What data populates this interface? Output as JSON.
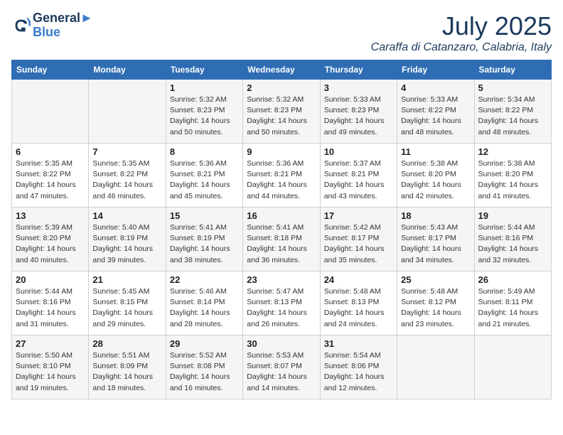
{
  "logo": {
    "line1": "General",
    "line2": "Blue"
  },
  "title": "July 2025",
  "location": "Caraffa di Catanzaro, Calabria, Italy",
  "days_of_week": [
    "Sunday",
    "Monday",
    "Tuesday",
    "Wednesday",
    "Thursday",
    "Friday",
    "Saturday"
  ],
  "weeks": [
    [
      {
        "day": "",
        "info": ""
      },
      {
        "day": "",
        "info": ""
      },
      {
        "day": "1",
        "info": "Sunrise: 5:32 AM\nSunset: 8:23 PM\nDaylight: 14 hours\nand 50 minutes."
      },
      {
        "day": "2",
        "info": "Sunrise: 5:32 AM\nSunset: 8:23 PM\nDaylight: 14 hours\nand 50 minutes."
      },
      {
        "day": "3",
        "info": "Sunrise: 5:33 AM\nSunset: 8:23 PM\nDaylight: 14 hours\nand 49 minutes."
      },
      {
        "day": "4",
        "info": "Sunrise: 5:33 AM\nSunset: 8:22 PM\nDaylight: 14 hours\nand 48 minutes."
      },
      {
        "day": "5",
        "info": "Sunrise: 5:34 AM\nSunset: 8:22 PM\nDaylight: 14 hours\nand 48 minutes."
      }
    ],
    [
      {
        "day": "6",
        "info": "Sunrise: 5:35 AM\nSunset: 8:22 PM\nDaylight: 14 hours\nand 47 minutes."
      },
      {
        "day": "7",
        "info": "Sunrise: 5:35 AM\nSunset: 8:22 PM\nDaylight: 14 hours\nand 46 minutes."
      },
      {
        "day": "8",
        "info": "Sunrise: 5:36 AM\nSunset: 8:21 PM\nDaylight: 14 hours\nand 45 minutes."
      },
      {
        "day": "9",
        "info": "Sunrise: 5:36 AM\nSunset: 8:21 PM\nDaylight: 14 hours\nand 44 minutes."
      },
      {
        "day": "10",
        "info": "Sunrise: 5:37 AM\nSunset: 8:21 PM\nDaylight: 14 hours\nand 43 minutes."
      },
      {
        "day": "11",
        "info": "Sunrise: 5:38 AM\nSunset: 8:20 PM\nDaylight: 14 hours\nand 42 minutes."
      },
      {
        "day": "12",
        "info": "Sunrise: 5:38 AM\nSunset: 8:20 PM\nDaylight: 14 hours\nand 41 minutes."
      }
    ],
    [
      {
        "day": "13",
        "info": "Sunrise: 5:39 AM\nSunset: 8:20 PM\nDaylight: 14 hours\nand 40 minutes."
      },
      {
        "day": "14",
        "info": "Sunrise: 5:40 AM\nSunset: 8:19 PM\nDaylight: 14 hours\nand 39 minutes."
      },
      {
        "day": "15",
        "info": "Sunrise: 5:41 AM\nSunset: 8:19 PM\nDaylight: 14 hours\nand 38 minutes."
      },
      {
        "day": "16",
        "info": "Sunrise: 5:41 AM\nSunset: 8:18 PM\nDaylight: 14 hours\nand 36 minutes."
      },
      {
        "day": "17",
        "info": "Sunrise: 5:42 AM\nSunset: 8:17 PM\nDaylight: 14 hours\nand 35 minutes."
      },
      {
        "day": "18",
        "info": "Sunrise: 5:43 AM\nSunset: 8:17 PM\nDaylight: 14 hours\nand 34 minutes."
      },
      {
        "day": "19",
        "info": "Sunrise: 5:44 AM\nSunset: 8:16 PM\nDaylight: 14 hours\nand 32 minutes."
      }
    ],
    [
      {
        "day": "20",
        "info": "Sunrise: 5:44 AM\nSunset: 8:16 PM\nDaylight: 14 hours\nand 31 minutes."
      },
      {
        "day": "21",
        "info": "Sunrise: 5:45 AM\nSunset: 8:15 PM\nDaylight: 14 hours\nand 29 minutes."
      },
      {
        "day": "22",
        "info": "Sunrise: 5:46 AM\nSunset: 8:14 PM\nDaylight: 14 hours\nand 28 minutes."
      },
      {
        "day": "23",
        "info": "Sunrise: 5:47 AM\nSunset: 8:13 PM\nDaylight: 14 hours\nand 26 minutes."
      },
      {
        "day": "24",
        "info": "Sunrise: 5:48 AM\nSunset: 8:13 PM\nDaylight: 14 hours\nand 24 minutes."
      },
      {
        "day": "25",
        "info": "Sunrise: 5:48 AM\nSunset: 8:12 PM\nDaylight: 14 hours\nand 23 minutes."
      },
      {
        "day": "26",
        "info": "Sunrise: 5:49 AM\nSunset: 8:11 PM\nDaylight: 14 hours\nand 21 minutes."
      }
    ],
    [
      {
        "day": "27",
        "info": "Sunrise: 5:50 AM\nSunset: 8:10 PM\nDaylight: 14 hours\nand 19 minutes."
      },
      {
        "day": "28",
        "info": "Sunrise: 5:51 AM\nSunset: 8:09 PM\nDaylight: 14 hours\nand 18 minutes."
      },
      {
        "day": "29",
        "info": "Sunrise: 5:52 AM\nSunset: 8:08 PM\nDaylight: 14 hours\nand 16 minutes."
      },
      {
        "day": "30",
        "info": "Sunrise: 5:53 AM\nSunset: 8:07 PM\nDaylight: 14 hours\nand 14 minutes."
      },
      {
        "day": "31",
        "info": "Sunrise: 5:54 AM\nSunset: 8:06 PM\nDaylight: 14 hours\nand 12 minutes."
      },
      {
        "day": "",
        "info": ""
      },
      {
        "day": "",
        "info": ""
      }
    ]
  ]
}
